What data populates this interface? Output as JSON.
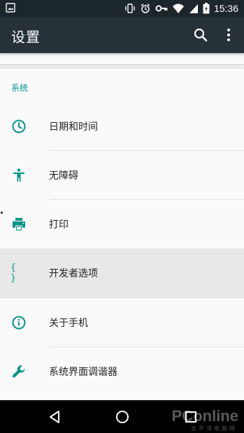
{
  "status_bar": {
    "time": "15:36",
    "icons": [
      "image-notification-icon",
      "vibrate-icon",
      "alarm-icon",
      "vpn-key-icon",
      "wifi-icon",
      "signal-icon",
      "battery-charging-icon"
    ]
  },
  "app_bar": {
    "title": "设置",
    "icons": [
      "search-icon",
      "more-vert-icon"
    ]
  },
  "section": {
    "header": "系统",
    "items": [
      {
        "label": "日期和时间",
        "icon": "clock-icon"
      },
      {
        "label": "无障碍",
        "icon": "accessibility-icon"
      },
      {
        "label": "打印",
        "icon": "printer-icon"
      },
      {
        "label": "开发者选项",
        "icon": "braces-icon",
        "icon_text": "{ }",
        "highlighted": true
      },
      {
        "label": "关于手机",
        "icon": "info-icon"
      },
      {
        "label": "系统界面调谐器",
        "icon": "wrench-icon"
      }
    ]
  },
  "nav_bar": {
    "icons": [
      "back-icon",
      "home-icon",
      "recents-icon"
    ]
  },
  "watermark": {
    "brand": "PConline",
    "sub": "太平洋电脑网"
  },
  "colors": {
    "status_bar": "#1c272c",
    "app_bar": "#263238",
    "accent": "#009688",
    "highlight": "#e8e8e8",
    "background": "#fafafa"
  }
}
